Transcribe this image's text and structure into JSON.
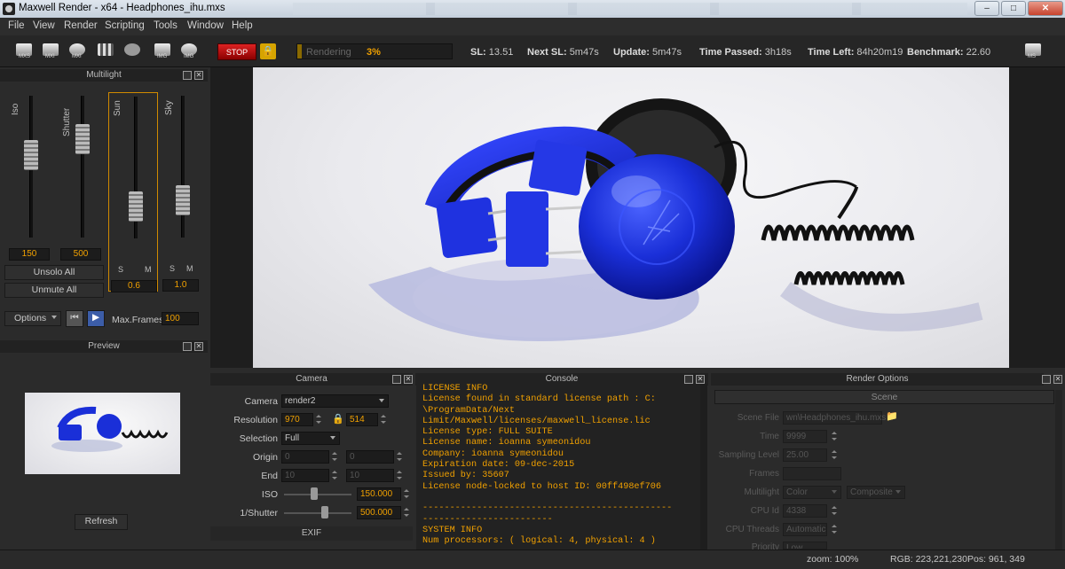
{
  "window": {
    "title": "Maxwell Render  - x64 - Headphones_ihu.mxs",
    "controls": [
      "–",
      "□",
      "✕"
    ]
  },
  "menu": [
    "File",
    "View",
    "Render",
    "Scripting",
    "Tools",
    "Window",
    "Help"
  ],
  "toolbar": {
    "icons": [
      {
        "name": "open-mxs-icon",
        "tag": "MXS"
      },
      {
        "name": "open-mxi-icon",
        "tag": "MXI"
      },
      {
        "name": "save-mxi-icon",
        "tag": "MXI"
      },
      {
        "name": "film-icon",
        "tag": ""
      },
      {
        "name": "refresh-icon",
        "tag": ""
      },
      {
        "name": "save-image-icon",
        "tag": "IMG"
      },
      {
        "name": "open-image-icon",
        "tag": "IMG"
      }
    ],
    "stop_label": "STOP",
    "lock_icon": "lock-icon",
    "progress": {
      "label": "Rendering",
      "percent_text": "3%",
      "percent": 3
    },
    "stats": [
      {
        "key": "SL:",
        "value": "13.51"
      },
      {
        "key": "Next SL:",
        "value": "5m47s"
      },
      {
        "key": "Update:",
        "value": "5m47s"
      },
      {
        "key": "Time Passed:",
        "value": "3h18s"
      },
      {
        "key": "Time Left:",
        "value": "84h20m19"
      },
      {
        "key": "Benchmark:",
        "value": "22.60"
      }
    ],
    "ms_tag": "MS"
  },
  "multilight": {
    "title": "Multilight",
    "channels": [
      {
        "label": "Iso",
        "value": "150",
        "level": 0.6
      },
      {
        "label": "Shutter",
        "value": "500",
        "level": 0.75
      },
      {
        "label": "Sun",
        "value": "0.6",
        "level": 0.15
      },
      {
        "label": "Sky",
        "value": "1.0",
        "level": 0.2
      }
    ],
    "s_label": "S",
    "m_label": "M",
    "unsolo": "Unsolo All",
    "unmute": "Unmute All",
    "options_label": "Options",
    "max_frames_label": "Max.Frames",
    "max_frames_value": "100"
  },
  "preview": {
    "title": "Preview",
    "refresh": "Refresh"
  },
  "camera": {
    "title": "Camera",
    "rows": {
      "camera": {
        "label": "Camera",
        "value": "render2"
      },
      "resolution": {
        "label": "Resolution",
        "w": "970",
        "h": "514"
      },
      "selection": {
        "label": "Selection",
        "value": "Full"
      },
      "origin": {
        "label": "Origin",
        "a": "0",
        "b": "0"
      },
      "end": {
        "label": "End",
        "a": "10",
        "b": "10"
      },
      "iso": {
        "label": "ISO",
        "value": "150.000",
        "level": 0.4
      },
      "shutter": {
        "label": "1/Shutter",
        "value": "500.000",
        "level": 0.55
      }
    },
    "exif": "EXIF"
  },
  "console": {
    "title": "Console",
    "text": "LICENSE INFO\nLicense found in standard license path : C:\n\\ProgramData/Next\nLimit/Maxwell/licenses/maxwell_license.lic\nLicense type: FULL SUITE\nLicense name: ioanna symeonidou\nCompany: ioanna symeonidou\nExpiration date: 09-dec-2015\nIssued by: 35607\nLicense node-locked to host ID: 00ff498ef706\n\n----------------------------------------------\n------------------------\nSYSTEM INFO\nNum processors: ( logical: 4, physical: 4 )"
  },
  "render_options": {
    "title": "Render Options",
    "tab": "Scene",
    "rows": {
      "scene_file": {
        "label": "Scene File",
        "value": "wn\\Headphones_ihu.mxs"
      },
      "time": {
        "label": "Time",
        "value": "9999"
      },
      "sampling": {
        "label": "Sampling Level",
        "value": "25.00"
      },
      "frames": {
        "label": "Frames",
        "value": ""
      },
      "multilight": {
        "label": "Multilight",
        "value": "Color",
        "value2": "Composite"
      },
      "cpu_id": {
        "label": "CPU Id",
        "value": "4338"
      },
      "cpu_threads": {
        "label": "CPU Threads",
        "value": "Automatic"
      },
      "priority": {
        "label": "Priority",
        "value": "Low"
      }
    }
  },
  "status": {
    "zoom": "zoom: 100%",
    "rgb": "RGB: 223,221,230",
    "pos": "Pos: 961, 349"
  },
  "colors": {
    "accent": "#f0a000",
    "render_blue": "#1a2fd8",
    "stop_red": "#cc1111"
  }
}
